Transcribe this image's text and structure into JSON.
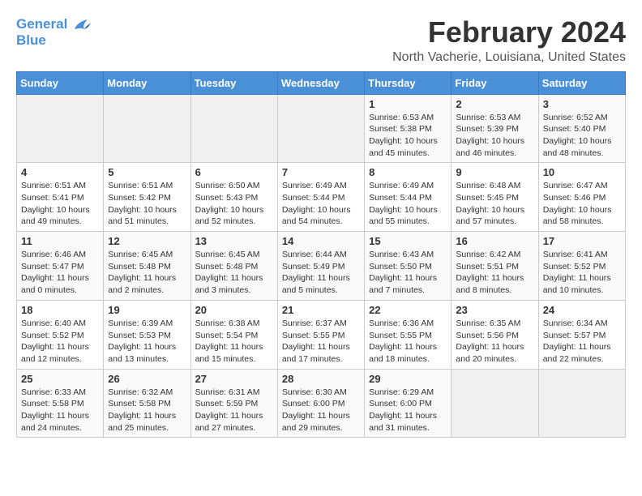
{
  "app": {
    "logo_line1": "General",
    "logo_line2": "Blue"
  },
  "header": {
    "title": "February 2024",
    "subtitle": "North Vacherie, Louisiana, United States"
  },
  "calendar": {
    "days_of_week": [
      "Sunday",
      "Monday",
      "Tuesday",
      "Wednesday",
      "Thursday",
      "Friday",
      "Saturday"
    ],
    "weeks": [
      [
        {
          "day": "",
          "sunrise": "",
          "sunset": "",
          "daylight": "",
          "empty": true
        },
        {
          "day": "",
          "sunrise": "",
          "sunset": "",
          "daylight": "",
          "empty": true
        },
        {
          "day": "",
          "sunrise": "",
          "sunset": "",
          "daylight": "",
          "empty": true
        },
        {
          "day": "",
          "sunrise": "",
          "sunset": "",
          "daylight": "",
          "empty": true
        },
        {
          "day": "1",
          "sunrise": "Sunrise: 6:53 AM",
          "sunset": "Sunset: 5:38 PM",
          "daylight": "Daylight: 10 hours and 45 minutes.",
          "empty": false
        },
        {
          "day": "2",
          "sunrise": "Sunrise: 6:53 AM",
          "sunset": "Sunset: 5:39 PM",
          "daylight": "Daylight: 10 hours and 46 minutes.",
          "empty": false
        },
        {
          "day": "3",
          "sunrise": "Sunrise: 6:52 AM",
          "sunset": "Sunset: 5:40 PM",
          "daylight": "Daylight: 10 hours and 48 minutes.",
          "empty": false
        }
      ],
      [
        {
          "day": "4",
          "sunrise": "Sunrise: 6:51 AM",
          "sunset": "Sunset: 5:41 PM",
          "daylight": "Daylight: 10 hours and 49 minutes.",
          "empty": false
        },
        {
          "day": "5",
          "sunrise": "Sunrise: 6:51 AM",
          "sunset": "Sunset: 5:42 PM",
          "daylight": "Daylight: 10 hours and 51 minutes.",
          "empty": false
        },
        {
          "day": "6",
          "sunrise": "Sunrise: 6:50 AM",
          "sunset": "Sunset: 5:43 PM",
          "daylight": "Daylight: 10 hours and 52 minutes.",
          "empty": false
        },
        {
          "day": "7",
          "sunrise": "Sunrise: 6:49 AM",
          "sunset": "Sunset: 5:44 PM",
          "daylight": "Daylight: 10 hours and 54 minutes.",
          "empty": false
        },
        {
          "day": "8",
          "sunrise": "Sunrise: 6:49 AM",
          "sunset": "Sunset: 5:44 PM",
          "daylight": "Daylight: 10 hours and 55 minutes.",
          "empty": false
        },
        {
          "day": "9",
          "sunrise": "Sunrise: 6:48 AM",
          "sunset": "Sunset: 5:45 PM",
          "daylight": "Daylight: 10 hours and 57 minutes.",
          "empty": false
        },
        {
          "day": "10",
          "sunrise": "Sunrise: 6:47 AM",
          "sunset": "Sunset: 5:46 PM",
          "daylight": "Daylight: 10 hours and 58 minutes.",
          "empty": false
        }
      ],
      [
        {
          "day": "11",
          "sunrise": "Sunrise: 6:46 AM",
          "sunset": "Sunset: 5:47 PM",
          "daylight": "Daylight: 11 hours and 0 minutes.",
          "empty": false
        },
        {
          "day": "12",
          "sunrise": "Sunrise: 6:45 AM",
          "sunset": "Sunset: 5:48 PM",
          "daylight": "Daylight: 11 hours and 2 minutes.",
          "empty": false
        },
        {
          "day": "13",
          "sunrise": "Sunrise: 6:45 AM",
          "sunset": "Sunset: 5:48 PM",
          "daylight": "Daylight: 11 hours and 3 minutes.",
          "empty": false
        },
        {
          "day": "14",
          "sunrise": "Sunrise: 6:44 AM",
          "sunset": "Sunset: 5:49 PM",
          "daylight": "Daylight: 11 hours and 5 minutes.",
          "empty": false
        },
        {
          "day": "15",
          "sunrise": "Sunrise: 6:43 AM",
          "sunset": "Sunset: 5:50 PM",
          "daylight": "Daylight: 11 hours and 7 minutes.",
          "empty": false
        },
        {
          "day": "16",
          "sunrise": "Sunrise: 6:42 AM",
          "sunset": "Sunset: 5:51 PM",
          "daylight": "Daylight: 11 hours and 8 minutes.",
          "empty": false
        },
        {
          "day": "17",
          "sunrise": "Sunrise: 6:41 AM",
          "sunset": "Sunset: 5:52 PM",
          "daylight": "Daylight: 11 hours and 10 minutes.",
          "empty": false
        }
      ],
      [
        {
          "day": "18",
          "sunrise": "Sunrise: 6:40 AM",
          "sunset": "Sunset: 5:52 PM",
          "daylight": "Daylight: 11 hours and 12 minutes.",
          "empty": false
        },
        {
          "day": "19",
          "sunrise": "Sunrise: 6:39 AM",
          "sunset": "Sunset: 5:53 PM",
          "daylight": "Daylight: 11 hours and 13 minutes.",
          "empty": false
        },
        {
          "day": "20",
          "sunrise": "Sunrise: 6:38 AM",
          "sunset": "Sunset: 5:54 PM",
          "daylight": "Daylight: 11 hours and 15 minutes.",
          "empty": false
        },
        {
          "day": "21",
          "sunrise": "Sunrise: 6:37 AM",
          "sunset": "Sunset: 5:55 PM",
          "daylight": "Daylight: 11 hours and 17 minutes.",
          "empty": false
        },
        {
          "day": "22",
          "sunrise": "Sunrise: 6:36 AM",
          "sunset": "Sunset: 5:55 PM",
          "daylight": "Daylight: 11 hours and 18 minutes.",
          "empty": false
        },
        {
          "day": "23",
          "sunrise": "Sunrise: 6:35 AM",
          "sunset": "Sunset: 5:56 PM",
          "daylight": "Daylight: 11 hours and 20 minutes.",
          "empty": false
        },
        {
          "day": "24",
          "sunrise": "Sunrise: 6:34 AM",
          "sunset": "Sunset: 5:57 PM",
          "daylight": "Daylight: 11 hours and 22 minutes.",
          "empty": false
        }
      ],
      [
        {
          "day": "25",
          "sunrise": "Sunrise: 6:33 AM",
          "sunset": "Sunset: 5:58 PM",
          "daylight": "Daylight: 11 hours and 24 minutes.",
          "empty": false
        },
        {
          "day": "26",
          "sunrise": "Sunrise: 6:32 AM",
          "sunset": "Sunset: 5:58 PM",
          "daylight": "Daylight: 11 hours and 25 minutes.",
          "empty": false
        },
        {
          "day": "27",
          "sunrise": "Sunrise: 6:31 AM",
          "sunset": "Sunset: 5:59 PM",
          "daylight": "Daylight: 11 hours and 27 minutes.",
          "empty": false
        },
        {
          "day": "28",
          "sunrise": "Sunrise: 6:30 AM",
          "sunset": "Sunset: 6:00 PM",
          "daylight": "Daylight: 11 hours and 29 minutes.",
          "empty": false
        },
        {
          "day": "29",
          "sunrise": "Sunrise: 6:29 AM",
          "sunset": "Sunset: 6:00 PM",
          "daylight": "Daylight: 11 hours and 31 minutes.",
          "empty": false
        },
        {
          "day": "",
          "sunrise": "",
          "sunset": "",
          "daylight": "",
          "empty": true
        },
        {
          "day": "",
          "sunrise": "",
          "sunset": "",
          "daylight": "",
          "empty": true
        }
      ]
    ]
  }
}
